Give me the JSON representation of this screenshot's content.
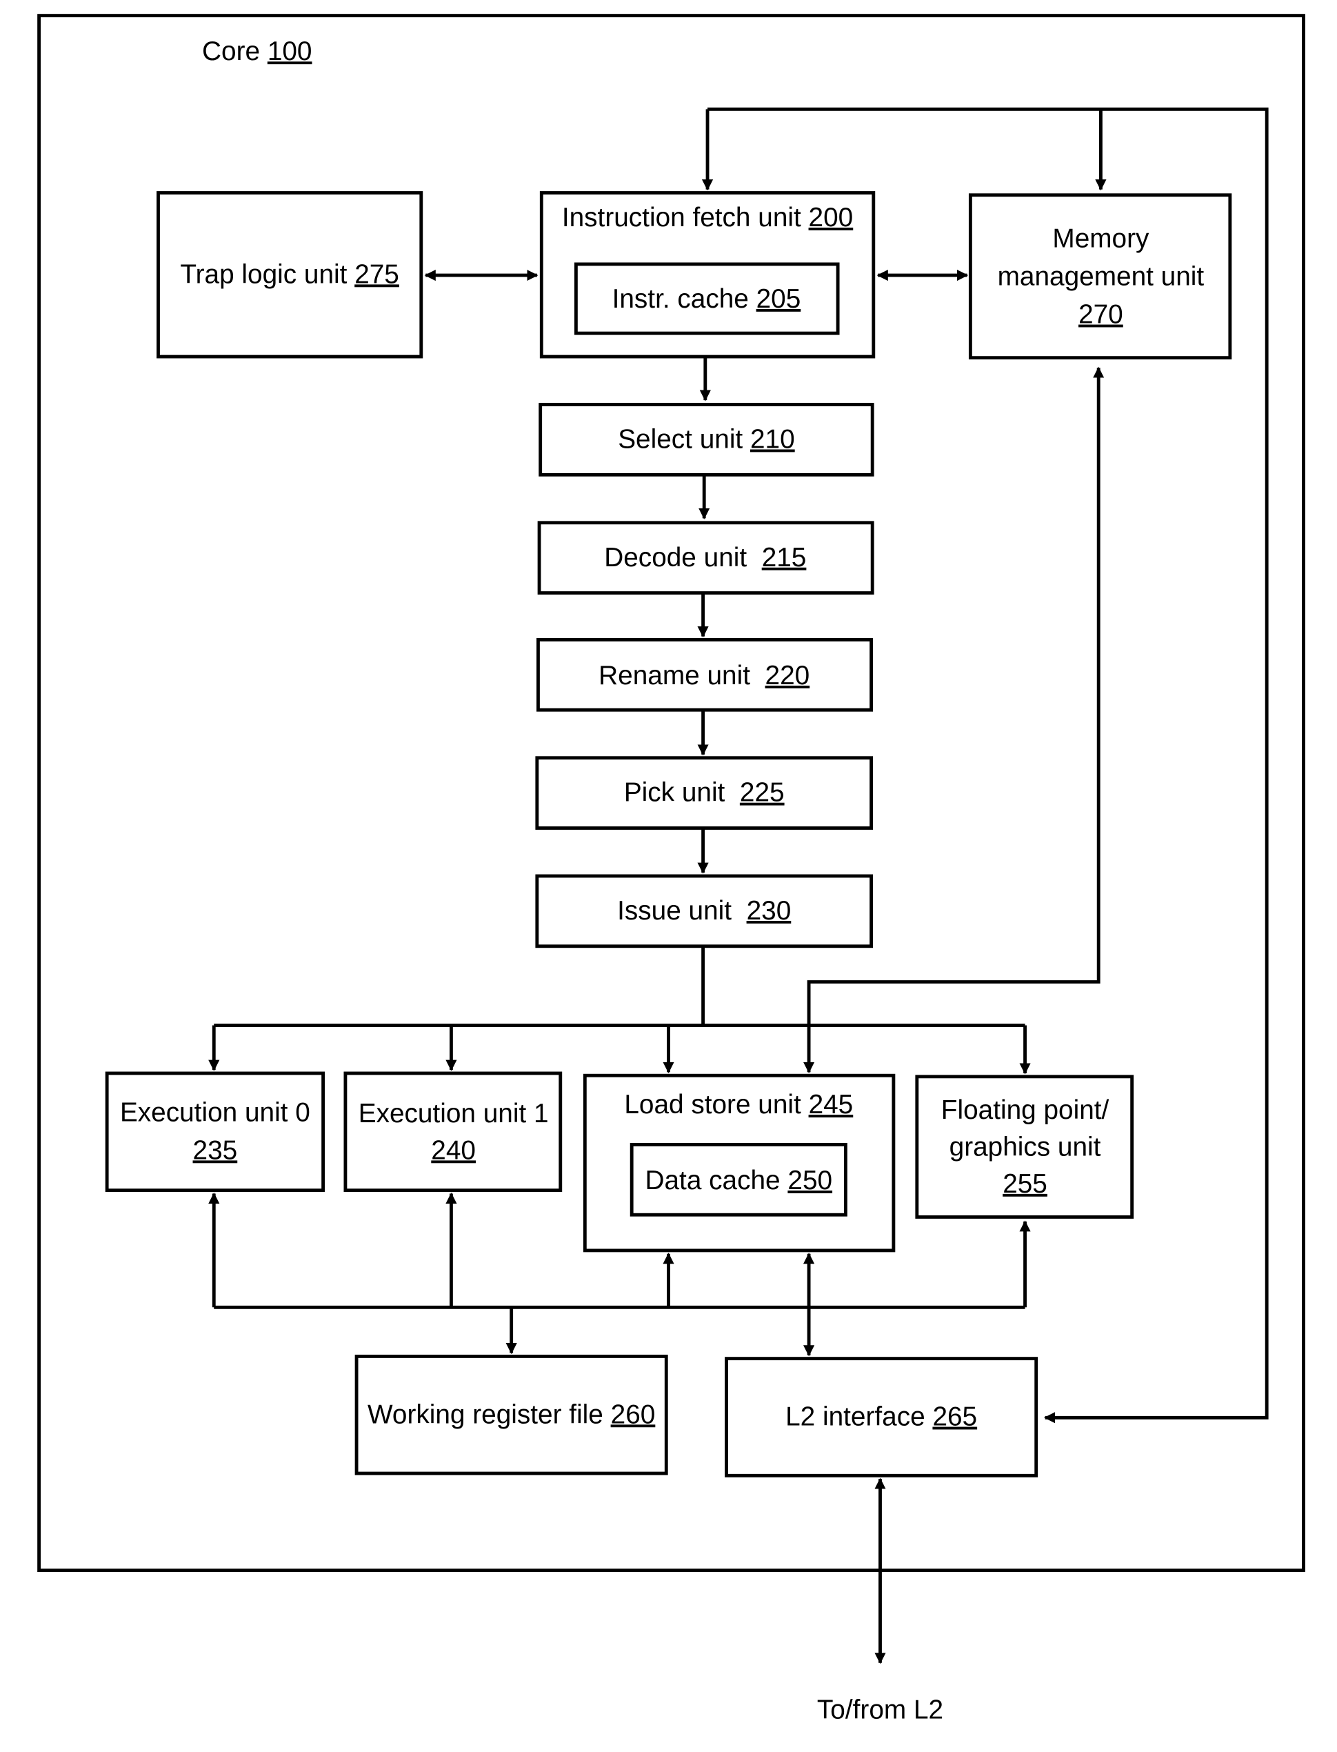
{
  "diagram": {
    "title": {
      "text": "Core ",
      "ref": "100"
    },
    "units": {
      "trap_logic": {
        "line1": "Trap logic unit ",
        "ref": "275"
      },
      "instruction_fetch": {
        "line1": "Instruction fetch unit ",
        "ref": "200"
      },
      "instr_cache": {
        "line1": "Instr. cache ",
        "ref": "205"
      },
      "mmu": {
        "line1": "Memory",
        "line2": "management unit",
        "ref": "270"
      },
      "select": {
        "line1": "Select unit ",
        "ref": "210"
      },
      "decode": {
        "line1": "Decode unit  ",
        "ref": "215"
      },
      "rename": {
        "line1": "Rename unit  ",
        "ref": "220"
      },
      "pick": {
        "line1": "Pick unit  ",
        "ref": "225"
      },
      "issue": {
        "line1": "Issue unit  ",
        "ref": "230"
      },
      "exec0": {
        "line1": "Execution unit 0",
        "ref": "235"
      },
      "exec1": {
        "line1": "Execution unit 1",
        "ref": "240"
      },
      "load_store": {
        "line1": "Load store unit ",
        "ref": "245"
      },
      "data_cache": {
        "line1": "Data cache ",
        "ref": "250"
      },
      "fpu": {
        "line1": "Floating point/",
        "line2": "graphics unit",
        "ref": "255"
      },
      "wrf": {
        "line1": "Working register file ",
        "ref": "260"
      },
      "l2": {
        "line1": "L2 interface ",
        "ref": "265"
      }
    },
    "external_label": "To/from L2"
  }
}
